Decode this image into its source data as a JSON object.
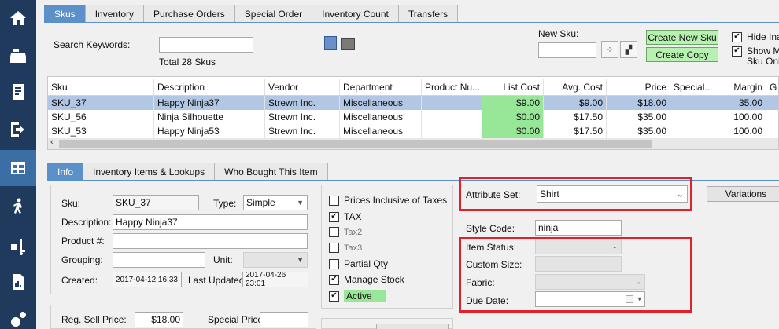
{
  "tabs": [
    "Skus",
    "Inventory",
    "Purchase Orders",
    "Special Order",
    "Inventory Count",
    "Transfers"
  ],
  "search": {
    "label": "Search Keywords:",
    "value": "",
    "total": "Total 28 Skus"
  },
  "new_sku": {
    "label": "New Sku:",
    "value": "",
    "create_new": "Create New Sku",
    "create_copy": "Create Copy"
  },
  "options": {
    "hide_inactive": "Hide Ina",
    "show_master_1": "Show Ma",
    "show_master_2": "Sku Only"
  },
  "grid": {
    "columns": [
      "Sku",
      "Description",
      "Vendor",
      "Department",
      "Product Nu...",
      "List Cost",
      "Avg. Cost",
      "Price",
      "Special...",
      "Margin",
      "G"
    ],
    "rows": [
      [
        "SKU_37",
        "Happy Ninja37",
        "Strewn Inc.",
        "Miscellaneous",
        "",
        "$9.00",
        "$9.00",
        "$18.00",
        "",
        "35.00",
        ""
      ],
      [
        "SKU_56",
        "Ninja Silhouette",
        "Strewn Inc.",
        "Miscellaneous",
        "",
        "$0.00",
        "$17.50",
        "$35.00",
        "",
        "100.00",
        ""
      ],
      [
        "SKU_53",
        "Happy Ninja53",
        "Strewn Inc.",
        "Miscellaneous",
        "",
        "$0.00",
        "$17.50",
        "$35.00",
        "",
        "100.00",
        ""
      ]
    ]
  },
  "detail_tabs": [
    "Info",
    "Inventory Items & Lookups",
    "Who Bought This Item"
  ],
  "info": {
    "sku_label": "Sku:",
    "sku_value": "SKU_37",
    "type_label": "Type:",
    "type_value": "Simple",
    "description_label": "Description:",
    "description_value": "Happy Ninja37",
    "product_label": "Product #:",
    "product_value": "",
    "grouping_label": "Grouping:",
    "grouping_value": "",
    "unit_label": "Unit:",
    "unit_value": "",
    "created_label": "Created:",
    "created_value": "2017-04-12 16:33",
    "updated_label": "Last Updated:",
    "updated_value": "2017-04-26 23:01",
    "reg_price_label": "Reg. Sell Price:",
    "reg_price_value": "$18.00",
    "special_price_label": "Special Price:",
    "special_price_value": ""
  },
  "flags": {
    "prices_inclusive": "Prices Inclusive of Taxes",
    "tax": "TAX",
    "tax2": "Tax2",
    "tax3": "Tax3",
    "partial_qty": "Partial Qty",
    "manage_stock": "Manage Stock",
    "active": "Active"
  },
  "attributes": {
    "attribute_set_label": "Attribute Set:",
    "attribute_set_value": "Shirt",
    "variations_button": "Variations",
    "style_code_label": "Style Code:",
    "style_code_value": "ninja",
    "item_status_label": "Item Status:",
    "custom_size_label": "Custom Size:",
    "fabric_label": "Fabric:",
    "due_date_label": "Due Date:"
  },
  "colors": {
    "sidebar": "#1f3a5c",
    "tab_active": "#5c90c8",
    "row_selected": "#b1c7e4",
    "cost_green": "#98e698",
    "highlight_red": "#e0202a"
  }
}
